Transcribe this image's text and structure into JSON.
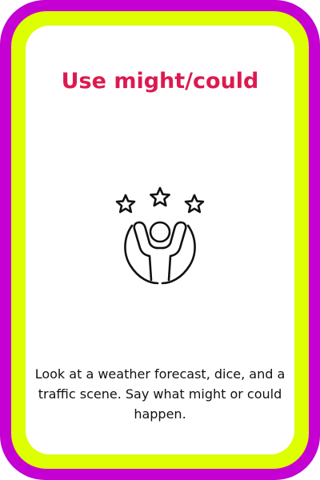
{
  "card": {
    "title": "Use might/could",
    "icon": "celebrating-person-with-stars-icon",
    "description": "Look at a weather forecast, dice, and a traffic scene. Say what might or could happen."
  },
  "colors": {
    "outer_border": "#c400d3",
    "inner_border": "#ddff00",
    "title": "#dc1a4f",
    "text": "#111111",
    "background": "#ffffff"
  }
}
